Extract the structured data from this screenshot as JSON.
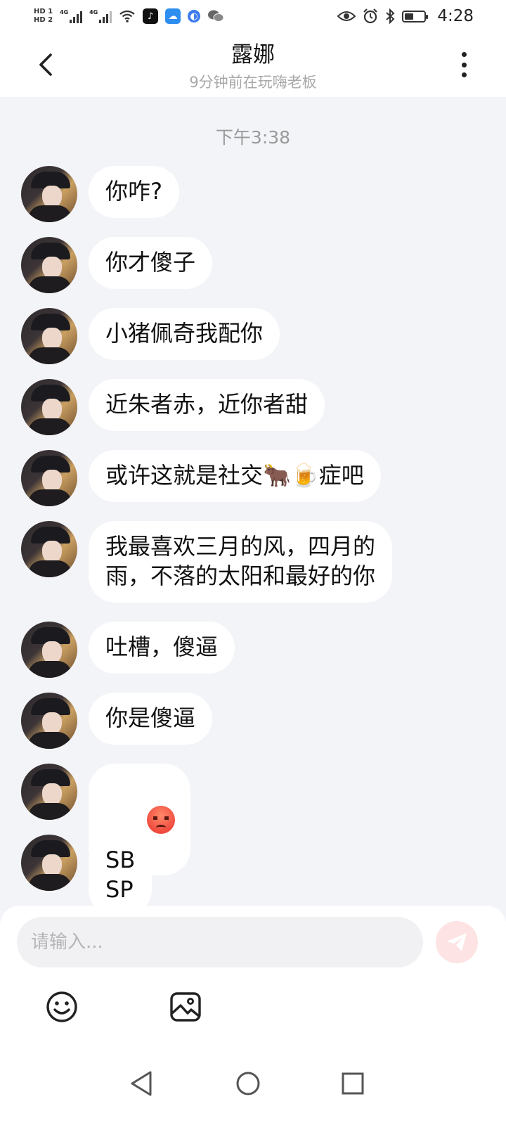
{
  "status_bar": {
    "time": "4:28",
    "hd1": "HD 1",
    "hd2": "HD 2",
    "net1": "4G",
    "net2": "4G",
    "battery_level": 0.45
  },
  "header": {
    "title": "露娜",
    "subtitle": "9分钟前在玩嗨老板"
  },
  "chat": {
    "timestamp": "下午3:38",
    "messages": [
      {
        "text": "你咋?"
      },
      {
        "text": "你才傻子"
      },
      {
        "text": "小猪佩奇我配你"
      },
      {
        "text": "近朱者赤，近你者甜"
      },
      {
        "text": "或许这就是社交🐂🍺症吧"
      },
      {
        "text": "我最喜欢三月的风，四月的\n雨，不落的太阳和最好的你"
      },
      {
        "text": "吐槽，傻逼"
      },
      {
        "text": "你是傻逼"
      },
      {
        "emoji": "angry-face-icon"
      },
      {
        "text": "SB\nSP"
      }
    ]
  },
  "composer": {
    "placeholder": "请输入..."
  },
  "colors": {
    "chat_bg": "#f3f4f8",
    "bubble_bg": "#ffffff",
    "send_button_bg": "#fde3e3",
    "send_icon": "#f8b6b6"
  },
  "icons": {
    "back": "chevron-left-icon",
    "more": "more-vertical-icon",
    "send": "paper-plane-icon",
    "emoji": "smiley-icon",
    "image": "image-icon",
    "nav_back": "triangle-back-icon",
    "nav_home": "circle-home-icon",
    "nav_recents": "square-recents-icon"
  }
}
